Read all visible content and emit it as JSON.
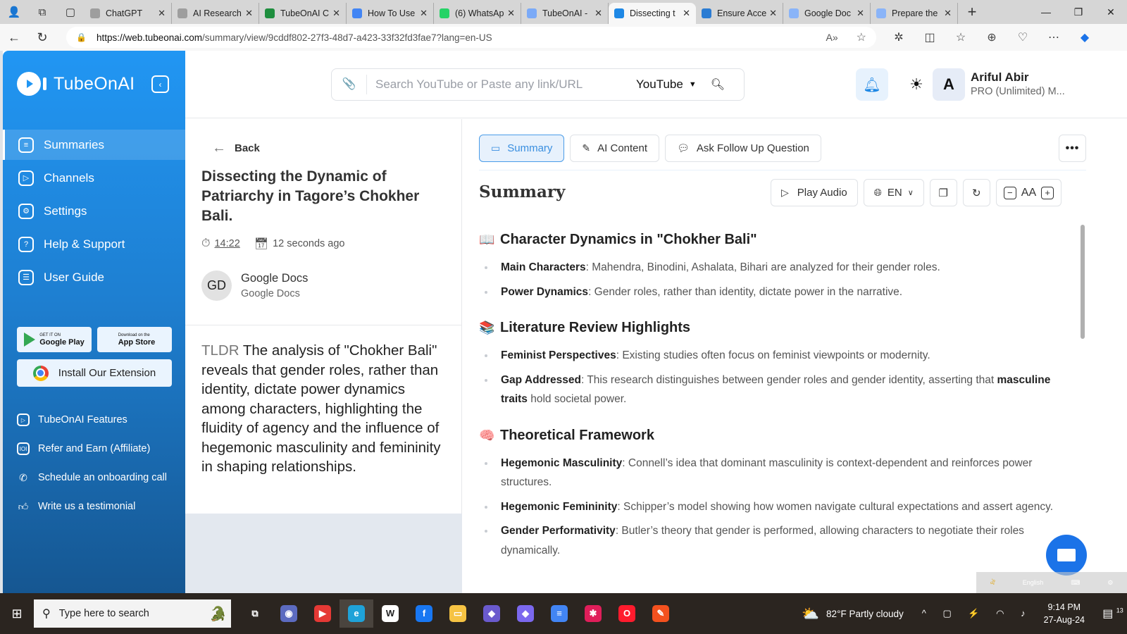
{
  "browser": {
    "tabs": [
      {
        "label": "ChatGPT",
        "color": "#9e9e9e",
        "active": false
      },
      {
        "label": "AI Research",
        "color": "#9e9e9e",
        "active": false
      },
      {
        "label": "TubeOnAI C",
        "color": "#1e8e3e",
        "active": false
      },
      {
        "label": "How To Use",
        "color": "#4285f4",
        "active": false
      },
      {
        "label": "(6) WhatsAp",
        "color": "#25d366",
        "active": false
      },
      {
        "label": "TubeOnAI -",
        "color": "#7baaf7",
        "active": false
      },
      {
        "label": "Dissecting t",
        "color": "#1e88e5",
        "active": true
      },
      {
        "label": "Ensure Acce",
        "color": "#2b7cd3",
        "active": false
      },
      {
        "label": "Google Doc",
        "color": "#8ab4f8",
        "active": false
      },
      {
        "label": "Prepare the",
        "color": "#8ab4f8",
        "active": false
      }
    ],
    "url_domain": "https://web.tubeonai.com",
    "url_path": "/summary/view/9cddf802-27f3-48d7-a423-33f32fd3fae7?lang=en-US"
  },
  "sidebar": {
    "brand": "TubeOnAI",
    "nav": [
      {
        "label": "Summaries",
        "icon": "summaries-icon",
        "active": true
      },
      {
        "label": "Channels",
        "icon": "channels-icon",
        "active": false
      },
      {
        "label": "Settings",
        "icon": "gear-icon",
        "active": false
      },
      {
        "label": "Help & Support",
        "icon": "help-icon",
        "active": false
      },
      {
        "label": "User Guide",
        "icon": "clipboard-icon",
        "active": false
      }
    ],
    "google_play": {
      "small": "GET IT ON",
      "big": "Google Play"
    },
    "app_store": {
      "small": "Download on the",
      "big": "App Store"
    },
    "extension_label": "Install Our Extension",
    "links": [
      {
        "label": "TubeOnAI Features",
        "icon": "play-box-icon"
      },
      {
        "label": "Refer and Earn (Affiliate)",
        "icon": "ticket-icon"
      },
      {
        "label": "Schedule an onboarding call",
        "icon": "phone-icon"
      },
      {
        "label": "Write us a testimonial",
        "icon": "thumbs-up-icon"
      }
    ]
  },
  "header": {
    "search_placeholder": "Search YouTube or Paste any link/URL",
    "search_source": "YouTube",
    "user_initial": "A",
    "user_name": "Ariful Abir",
    "user_plan": "PRO (Unlimited) M..."
  },
  "detail": {
    "back_label": "Back",
    "title": "Dissecting the Dynamic of Patriarchy in Tagore’s Chokher Bali.",
    "duration": "14:22",
    "created": "12 seconds ago",
    "channel_initials": "GD",
    "channel_name": "Google Docs",
    "channel_sub": "Google Docs",
    "tldr_label": "TLDR",
    "tldr_text": "The analysis of \"Chokher Bali\" reveals that gender roles, rather than identity, dictate power dynamics among characters, highlighting the fluidity of agency and the influence of hegemonic masculinity and femininity in shaping relationships."
  },
  "content": {
    "tabs": [
      {
        "label": "Summary",
        "active": true
      },
      {
        "label": "AI Content",
        "active": false
      },
      {
        "label": "Ask Follow Up Question",
        "active": false
      }
    ],
    "title": "Summary",
    "play_audio": "Play Audio",
    "language": "EN",
    "font_size_label": "AA",
    "sections": [
      {
        "emoji": "📖",
        "heading": "Character Dynamics in \"Chokher Bali\"",
        "items": [
          {
            "term": "Main Characters",
            "text": ": Mahendra, Binodini, Ashalata, Bihari are analyzed for their gender roles."
          },
          {
            "term": "Power Dynamics",
            "text": ": Gender roles, rather than identity, dictate power in the narrative."
          }
        ]
      },
      {
        "emoji": "📚",
        "heading": "Literature Review Highlights",
        "items": [
          {
            "term": "Feminist Perspectives",
            "text": ": Existing studies often focus on feminist viewpoints or modernity."
          },
          {
            "term": "Gap Addressed",
            "text": ": This research distinguishes between gender roles and gender identity, asserting that ",
            "term2": "masculine traits",
            "text2": " hold societal power."
          }
        ]
      },
      {
        "emoji": "🧠",
        "heading": "Theoretical Framework",
        "items": [
          {
            "term": "Hegemonic Masculinity",
            "text": ": Connell’s idea that dominant masculinity is context-dependent and reinforces power structures."
          },
          {
            "term": "Hegemonic Femininity",
            "text": ": Schipper’s model showing how women navigate cultural expectations and assert agency."
          },
          {
            "term": "Gender Performativity",
            "text": ": Butler’s theory that gender is performed, allowing characters to negotiate their roles dynamically."
          }
        ]
      }
    ]
  },
  "ime_bar": {
    "language": "English"
  },
  "taskbar": {
    "search_placeholder": "Type here to search",
    "apps": [
      {
        "name": "task-view",
        "color": "transparent",
        "glyph": "⧉"
      },
      {
        "name": "camera",
        "color": "#5c6bc0",
        "glyph": "◉"
      },
      {
        "name": "youtube",
        "color": "#e53935",
        "glyph": "▶"
      },
      {
        "name": "edge",
        "color": "#1fa2d8",
        "glyph": "e",
        "active": true
      },
      {
        "name": "wikipedia",
        "color": "#ffffff",
        "glyph": "W"
      },
      {
        "name": "facebook",
        "color": "#1877f2",
        "glyph": "f"
      },
      {
        "name": "file-explorer",
        "color": "#f6c343",
        "glyph": "▭"
      },
      {
        "name": "copilot-1",
        "color": "#6a5acd",
        "glyph": "◆"
      },
      {
        "name": "copilot-2",
        "color": "#7b68ee",
        "glyph": "◆"
      },
      {
        "name": "google-docs",
        "color": "#4285f4",
        "glyph": "≡"
      },
      {
        "name": "slack",
        "color": "#e01e5a",
        "glyph": "✱"
      },
      {
        "name": "opera",
        "color": "#ff1b2d",
        "glyph": "O"
      },
      {
        "name": "app-orange",
        "color": "#f4511e",
        "glyph": "✎"
      }
    ],
    "weather": "82°F  Partly cloudy",
    "time": "9:14 PM",
    "date": "27-Aug-24",
    "notifications": "13"
  }
}
